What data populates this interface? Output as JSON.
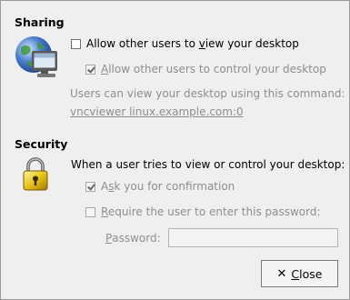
{
  "sharing": {
    "heading": "Sharing",
    "allow_view": {
      "prefix": "Allow other users to ",
      "mnemonic": "v",
      "suffix": "iew your desktop",
      "checked": false
    },
    "allow_control": {
      "mnemonic": "A",
      "suffix": "llow other users to control your desktop",
      "checked": true
    },
    "command_label": "Users can view your desktop using this command:",
    "command": "vncviewer linux.example.com:0"
  },
  "security": {
    "heading": "Security",
    "intro": "When a user tries to view or control your desktop:",
    "ask_confirm": {
      "prefix": "A",
      "mnemonic": "s",
      "suffix": "k you for confirmation",
      "checked": true
    },
    "require_password": {
      "mnemonic": "R",
      "suffix": "equire the user to enter this password:",
      "checked": false
    },
    "password": {
      "mnemonic": "P",
      "suffix": "assword:",
      "value": ""
    }
  },
  "footer": {
    "close_mnemonic": "C",
    "close_suffix": "lose"
  },
  "icons": {
    "sharing": "monitor-globe-icon",
    "security": "padlock-icon",
    "close": "close-x-icon"
  }
}
